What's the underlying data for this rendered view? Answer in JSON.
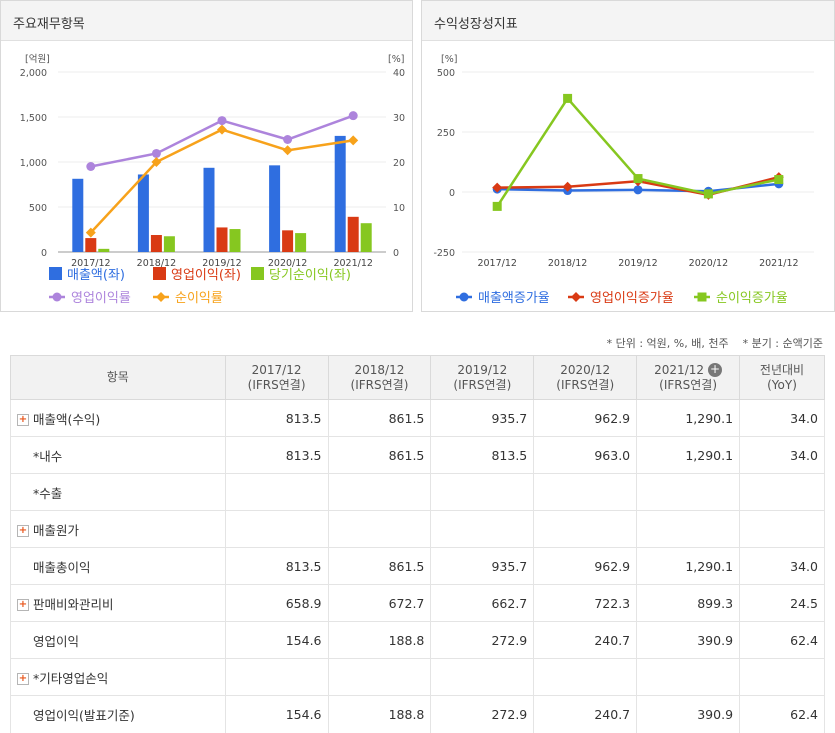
{
  "panels": {
    "left_title": "주요재무항목",
    "right_title": "수익성장성지표"
  },
  "chart_data": [
    {
      "type": "bar",
      "title": "주요재무항목",
      "categories": [
        "2017/12",
        "2018/12",
        "2019/12",
        "2020/12",
        "2021/12"
      ],
      "y_left_label": "[억원]",
      "y_right_label": "[%]",
      "ylim_left": [
        0,
        2000
      ],
      "ylim_right": [
        0,
        40
      ],
      "ticks_left": [
        "2,000",
        "1,500",
        "1,000",
        "500",
        "0"
      ],
      "ticks_right": [
        "40",
        "30",
        "20",
        "10",
        "0"
      ],
      "bars": [
        {
          "name": "매출액(좌)",
          "color": "#2f6ee0",
          "values": [
            813.5,
            861.5,
            935.7,
            962.9,
            1290.1
          ]
        },
        {
          "name": "영업이익(좌)",
          "color": "#d93a14",
          "values": [
            154.6,
            188.8,
            272.9,
            240.7,
            390.9
          ]
        },
        {
          "name": "당기순이익(좌)",
          "color": "#86c720",
          "values": [
            35,
            175,
            255,
            210,
            320
          ]
        }
      ],
      "lines": [
        {
          "name": "영업이익률",
          "color": "#ad84dc",
          "values": [
            19.0,
            21.9,
            29.2,
            25.0,
            30.3
          ]
        },
        {
          "name": "순이익률",
          "color": "#f7a21b",
          "values": [
            4.3,
            20.0,
            27.2,
            22.6,
            24.8
          ]
        }
      ]
    },
    {
      "type": "line",
      "title": "수익성장성지표",
      "categories": [
        "2017/12",
        "2018/12",
        "2019/12",
        "2020/12",
        "2021/12"
      ],
      "y_label": "[%]",
      "ylim": [
        -250,
        500
      ],
      "ticks": [
        "500",
        "250",
        "0",
        "-250"
      ],
      "series": [
        {
          "name": "매출액증가율",
          "color": "#2f6ee0",
          "marker": "circle",
          "values": [
            12,
            6,
            9,
            3,
            34
          ]
        },
        {
          "name": "영업이익증가율",
          "color": "#d93a14",
          "marker": "diamond",
          "values": [
            18,
            22,
            45,
            -12,
            62
          ]
        },
        {
          "name": "순이익증가율",
          "color": "#86c720",
          "marker": "square",
          "values": [
            -60,
            390,
            56,
            -8,
            52
          ]
        }
      ]
    }
  ],
  "units_note": "* 단위 : 억원, %, 배, 천주    * 분기 : 순액기준",
  "table": {
    "header": {
      "item": "항목",
      "columns": [
        {
          "year": "2017/12",
          "sub": "(IFRS연결)"
        },
        {
          "year": "2018/12",
          "sub": "(IFRS연결)"
        },
        {
          "year": "2019/12",
          "sub": "(IFRS연결)"
        },
        {
          "year": "2020/12",
          "sub": "(IFRS연결)"
        },
        {
          "year": "2021/12",
          "sub": "(IFRS연결)"
        }
      ],
      "yoy": "전년대비",
      "yoy_sub": "(YoY)",
      "expand_icon": "+"
    },
    "rows": [
      {
        "label": "매출액(수익)",
        "values": [
          "813.5",
          "861.5",
          "935.7",
          "962.9",
          "1,290.1",
          "34.0"
        ]
      },
      {
        "label": "*내수",
        "values": [
          "813.5",
          "861.5",
          "813.5",
          "963.0",
          "1,290.1",
          "34.0"
        ]
      },
      {
        "label": "*수출",
        "values": [
          "",
          "",
          "",
          "",
          "",
          ""
        ]
      },
      {
        "label": "매출원가",
        "values": [
          "",
          "",
          "",
          "",
          "",
          ""
        ]
      },
      {
        "label": "매출총이익",
        "values": [
          "813.5",
          "861.5",
          "935.7",
          "962.9",
          "1,290.1",
          "34.0"
        ]
      },
      {
        "label": "판매비와관리비",
        "values": [
          "658.9",
          "672.7",
          "662.7",
          "722.3",
          "899.3",
          "24.5"
        ]
      },
      {
        "label": "영업이익",
        "values": [
          "154.6",
          "188.8",
          "272.9",
          "240.7",
          "390.9",
          "62.4"
        ]
      },
      {
        "label": "*기타영업손익",
        "values": [
          "",
          "",
          "",
          "",
          "",
          ""
        ]
      },
      {
        "label": "영업이익(발표기준)",
        "values": [
          "154.6",
          "188.8",
          "272.9",
          "240.7",
          "390.9",
          "62.4"
        ]
      }
    ]
  }
}
